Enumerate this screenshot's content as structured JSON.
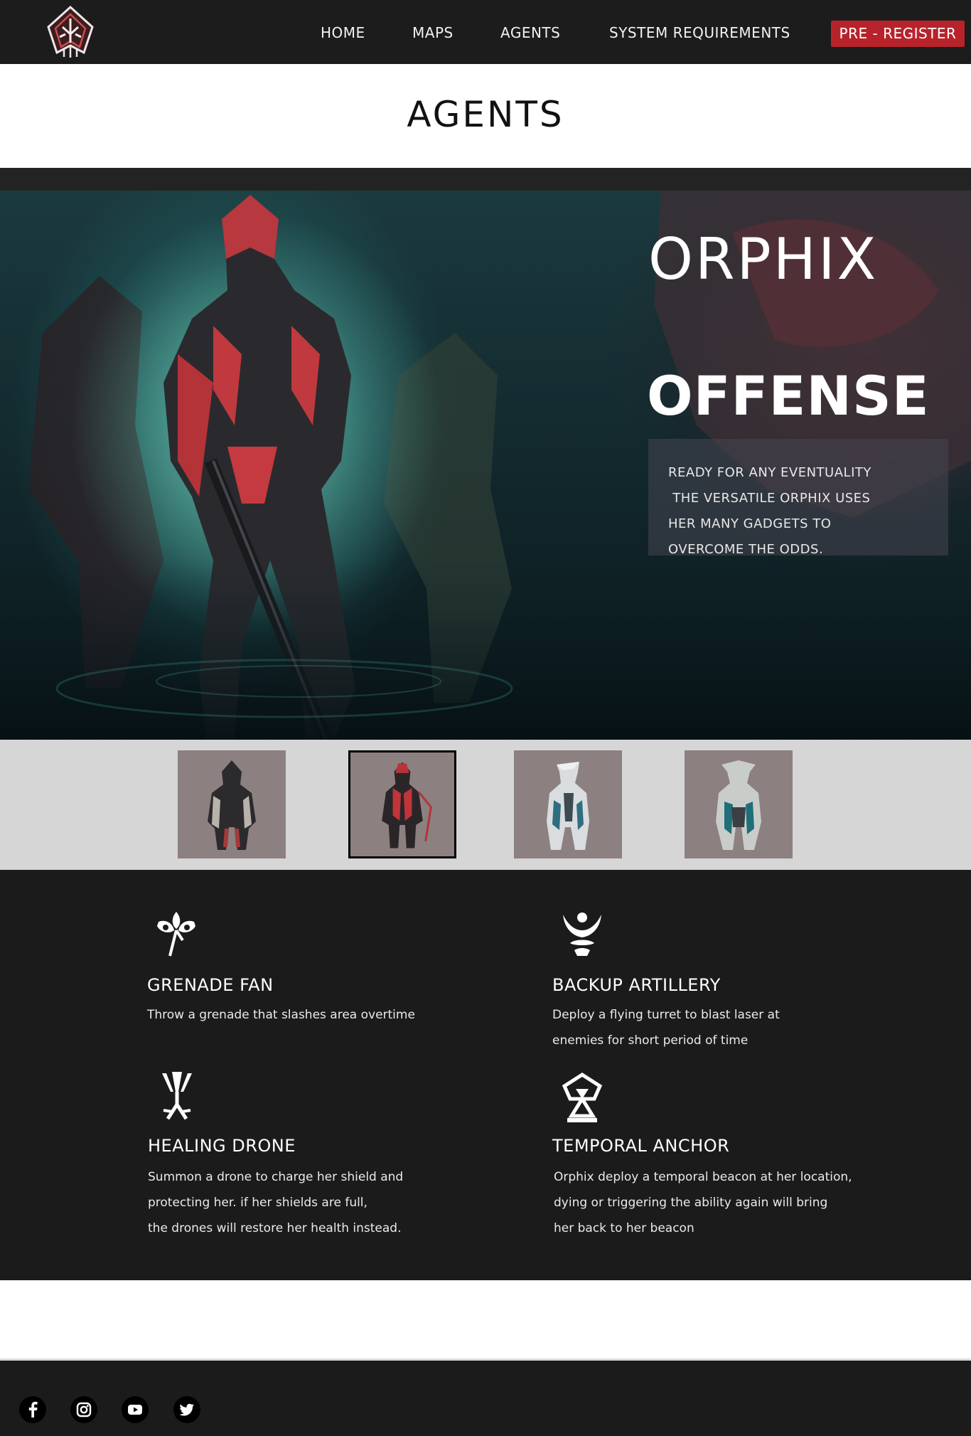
{
  "nav": {
    "logo": "warframe-logo",
    "links": [
      "HOME",
      "MAPS",
      "AGENTS",
      "SYSTEM REQUIREMENTS"
    ],
    "cta": "PRE - REGISTER"
  },
  "page_title": "AGENTS",
  "hero": {
    "name": "ORPHIX",
    "role": "OFFENSE",
    "description": [
      "READY FOR ANY EVENTUALITY",
      " THE VERSATILE ORPHIX USES",
      "HER MANY GADGETS TO",
      "OVERCOME THE ODDS."
    ]
  },
  "agents": {
    "selected_index": 1,
    "thumbnails": [
      "agent-1-portrait",
      "agent-orphix-portrait",
      "agent-3-portrait",
      "agent-4-portrait"
    ]
  },
  "abilities": [
    {
      "icon": "grenade-fan-icon",
      "title": "GRENADE FAN",
      "lines": [
        "Throw a grenade that slashes area overtime"
      ]
    },
    {
      "icon": "backup-artillery-icon",
      "title": "BACKUP ARTILLERY",
      "lines": [
        "Deploy a flying turret to blast laser at",
        "enemies for short period of time"
      ]
    },
    {
      "icon": "healing-drone-icon",
      "title": "HEALING DRONE",
      "lines": [
        "Summon a drone to charge her shield and",
        "protecting her. if her shields are full,",
        "the drones will restore her health instead."
      ]
    },
    {
      "icon": "temporal-anchor-icon",
      "title": "TEMPORAL ANCHOR",
      "lines": [
        "Orphix deploy a temporal beacon at her location,",
        "dying or triggering the ability again will bring",
        "her back to her beacon"
      ]
    }
  ],
  "colors": {
    "nav_bg": "#1c1c1c",
    "cta_bg": "#b8232b",
    "abilities_bg": "#1b1b1c",
    "thumb_strip_bg": "#d6d6d6",
    "thumb_bg": "#8d8080"
  },
  "footer": {
    "social": [
      "facebook-icon",
      "instagram-icon",
      "youtube-icon",
      "twitter-icon"
    ]
  }
}
